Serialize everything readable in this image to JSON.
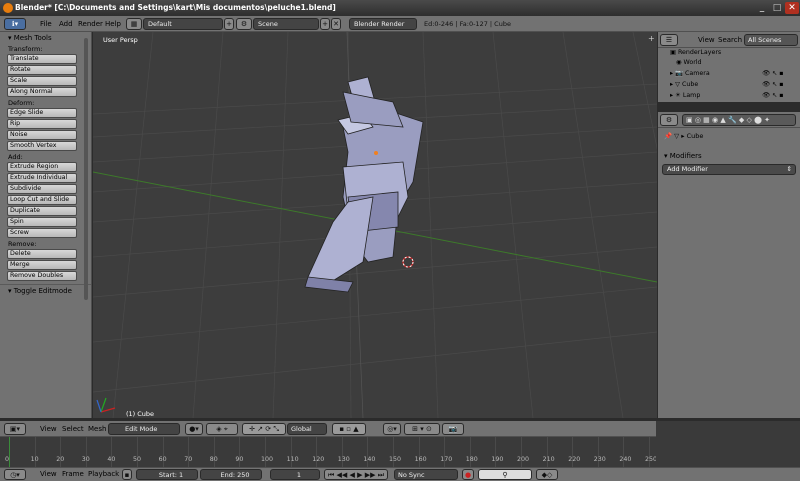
{
  "window": {
    "title": "Blender* [C:\\Documents and Settings\\kart\\Mis documentos\\peluche1.blend]",
    "btn_min": "_",
    "btn_max": "□",
    "btn_close": "✕"
  },
  "info_header": {
    "menus": [
      "File",
      "Add",
      "Render",
      "Help"
    ],
    "layout": "Default",
    "scene": "Scene",
    "engine": "Blender Render",
    "stats": "Ed:0-246 | Fa:0-127 | Cube"
  },
  "toolshelf": {
    "title": "Mesh Tools",
    "groups": [
      {
        "label": "Transform:",
        "buttons": [
          "Translate",
          "Rotate",
          "Scale",
          "Along Normal"
        ]
      },
      {
        "label": "Deform:",
        "buttons": [
          "Edge Slide",
          "Rip",
          "Noise",
          "Smooth Vertex"
        ]
      },
      {
        "label": "Add:",
        "buttons": [
          "Extrude Region",
          "Extrude Individual",
          "Subdivide",
          "Loop Cut and Slide",
          "Duplicate",
          "Spin",
          "Screw"
        ]
      },
      {
        "label": "Remove:",
        "buttons": [
          "Delete",
          "Merge",
          "Remove Doubles"
        ]
      }
    ],
    "toggle": "Toggle Editmode"
  },
  "viewport": {
    "view_label": "User Persp",
    "object_label": "(1) Cube"
  },
  "outliner": {
    "menus": [
      "View",
      "Search"
    ],
    "filter": "All Scenes",
    "rows": [
      "RenderLayers",
      "World",
      "Camera",
      "Cube",
      "Lamp"
    ]
  },
  "properties": {
    "breadcrumb": "Cube",
    "modifiers_title": "Modifiers",
    "add_modifier": "Add Modifier"
  },
  "view3d_header": {
    "menus": [
      "View",
      "Select",
      "Mesh"
    ],
    "mode": "Edit Mode",
    "orientation": "Global"
  },
  "timeline": {
    "ticks": [
      "0",
      "10",
      "20",
      "30",
      "40",
      "50",
      "60",
      "70",
      "80",
      "90",
      "100",
      "110",
      "120",
      "130",
      "140",
      "150",
      "160",
      "170",
      "180",
      "190",
      "200",
      "210",
      "220",
      "230",
      "240",
      "250"
    ]
  },
  "bottom_header": {
    "menus": [
      "View",
      "Frame",
      "Playback"
    ],
    "start": "Start: 1",
    "end": "End: 250",
    "frame": "1",
    "sync": "No Sync"
  }
}
